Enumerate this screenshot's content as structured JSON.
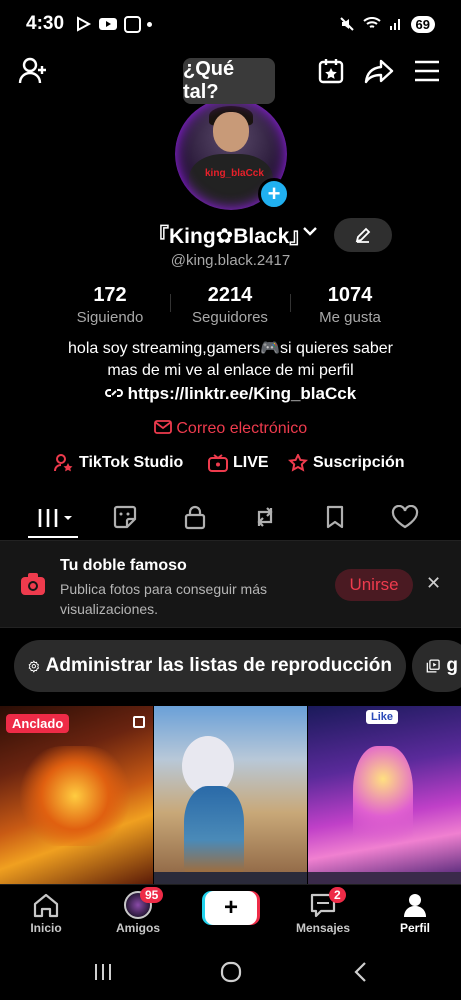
{
  "status_bar": {
    "time": "4:30",
    "battery": "69"
  },
  "tooltip": "¿Qué tal?",
  "avatar": {
    "caption": "king_blaCck"
  },
  "profile": {
    "name": "『King✿Black』",
    "handle": "@king.black.2417"
  },
  "stats": [
    {
      "value": "172",
      "label": "Siguiendo"
    },
    {
      "value": "2214",
      "label": "Seguidores"
    },
    {
      "value": "1074",
      "label": "Me gusta"
    }
  ],
  "bio": {
    "line1": "hola soy streaming,gamers🎮si quieres saber",
    "line2": "mas de mi ve al enlace de mi perfil"
  },
  "link": "https://linktr.ee/King_blaCck",
  "email_label": "Correo electrónico",
  "features": {
    "studio": "TikTok Studio",
    "live": "LIVE",
    "subscription": "Suscripción"
  },
  "banner": {
    "title": "Tu doble famoso",
    "text": "Publica fotos para conseguir más visualizaciones.",
    "join": "Unirse"
  },
  "playlists": {
    "manage": "Administrar las listas de reproducción",
    "second": "g"
  },
  "grid": {
    "pinned": "Anclado",
    "like": "Like"
  },
  "bottom_nav": {
    "home": "Inicio",
    "friends": "Amigos",
    "friends_badge": "95",
    "messages": "Mensajes",
    "messages_badge": "2",
    "profile": "Perfil"
  },
  "colors": {
    "accent": "#ee3b4d",
    "badge": "#20b0f0"
  }
}
